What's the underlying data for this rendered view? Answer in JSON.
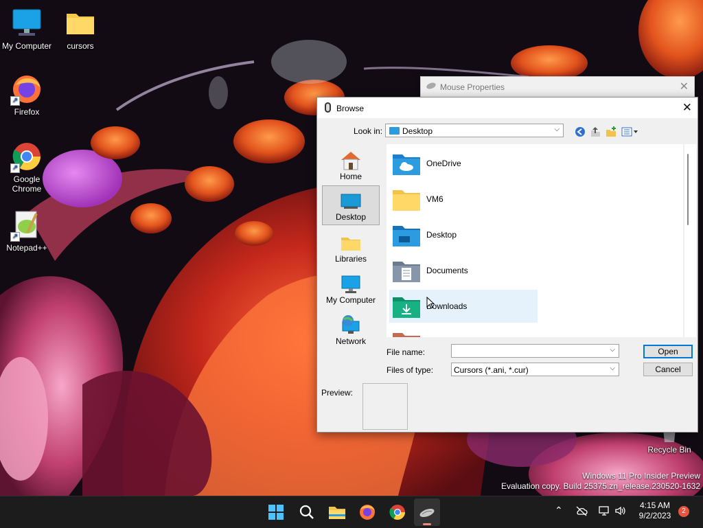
{
  "desktop": {
    "icons": [
      {
        "label": "My Computer"
      },
      {
        "label": "cursors"
      },
      {
        "label": "Firefox"
      },
      {
        "label": "Google Chrome"
      },
      {
        "label": "Notepad++"
      },
      {
        "label": "Recycle Bin"
      }
    ],
    "watermark_line1": "Windows 11 Pro Insider Preview",
    "watermark_line2": "Evaluation copy. Build 25375.zn_release.230520-1632"
  },
  "mouse_properties": {
    "title": "Mouse Properties",
    "close": "✕"
  },
  "browse": {
    "title": "Browse",
    "close": "✕",
    "look_in_label": "Look in:",
    "look_in_value": "Desktop",
    "places": [
      {
        "label": "Home"
      },
      {
        "label": "Desktop"
      },
      {
        "label": "Libraries"
      },
      {
        "label": "My Computer"
      },
      {
        "label": "Network"
      }
    ],
    "files": [
      {
        "name": "OneDrive"
      },
      {
        "name": "VM6"
      },
      {
        "name": "Desktop"
      },
      {
        "name": "Documents"
      },
      {
        "name": "Downloads"
      }
    ],
    "file_name_label": "File name:",
    "file_name_value": "",
    "files_of_type_label": "Files of type:",
    "files_of_type_value": "Cursors (*.ani, *.cur)",
    "open_label": "Open",
    "cancel_label": "Cancel",
    "preview_label": "Preview:"
  },
  "taskbar": {
    "time": "4:15 AM",
    "date": "9/2/2023",
    "notification_count": "2"
  }
}
